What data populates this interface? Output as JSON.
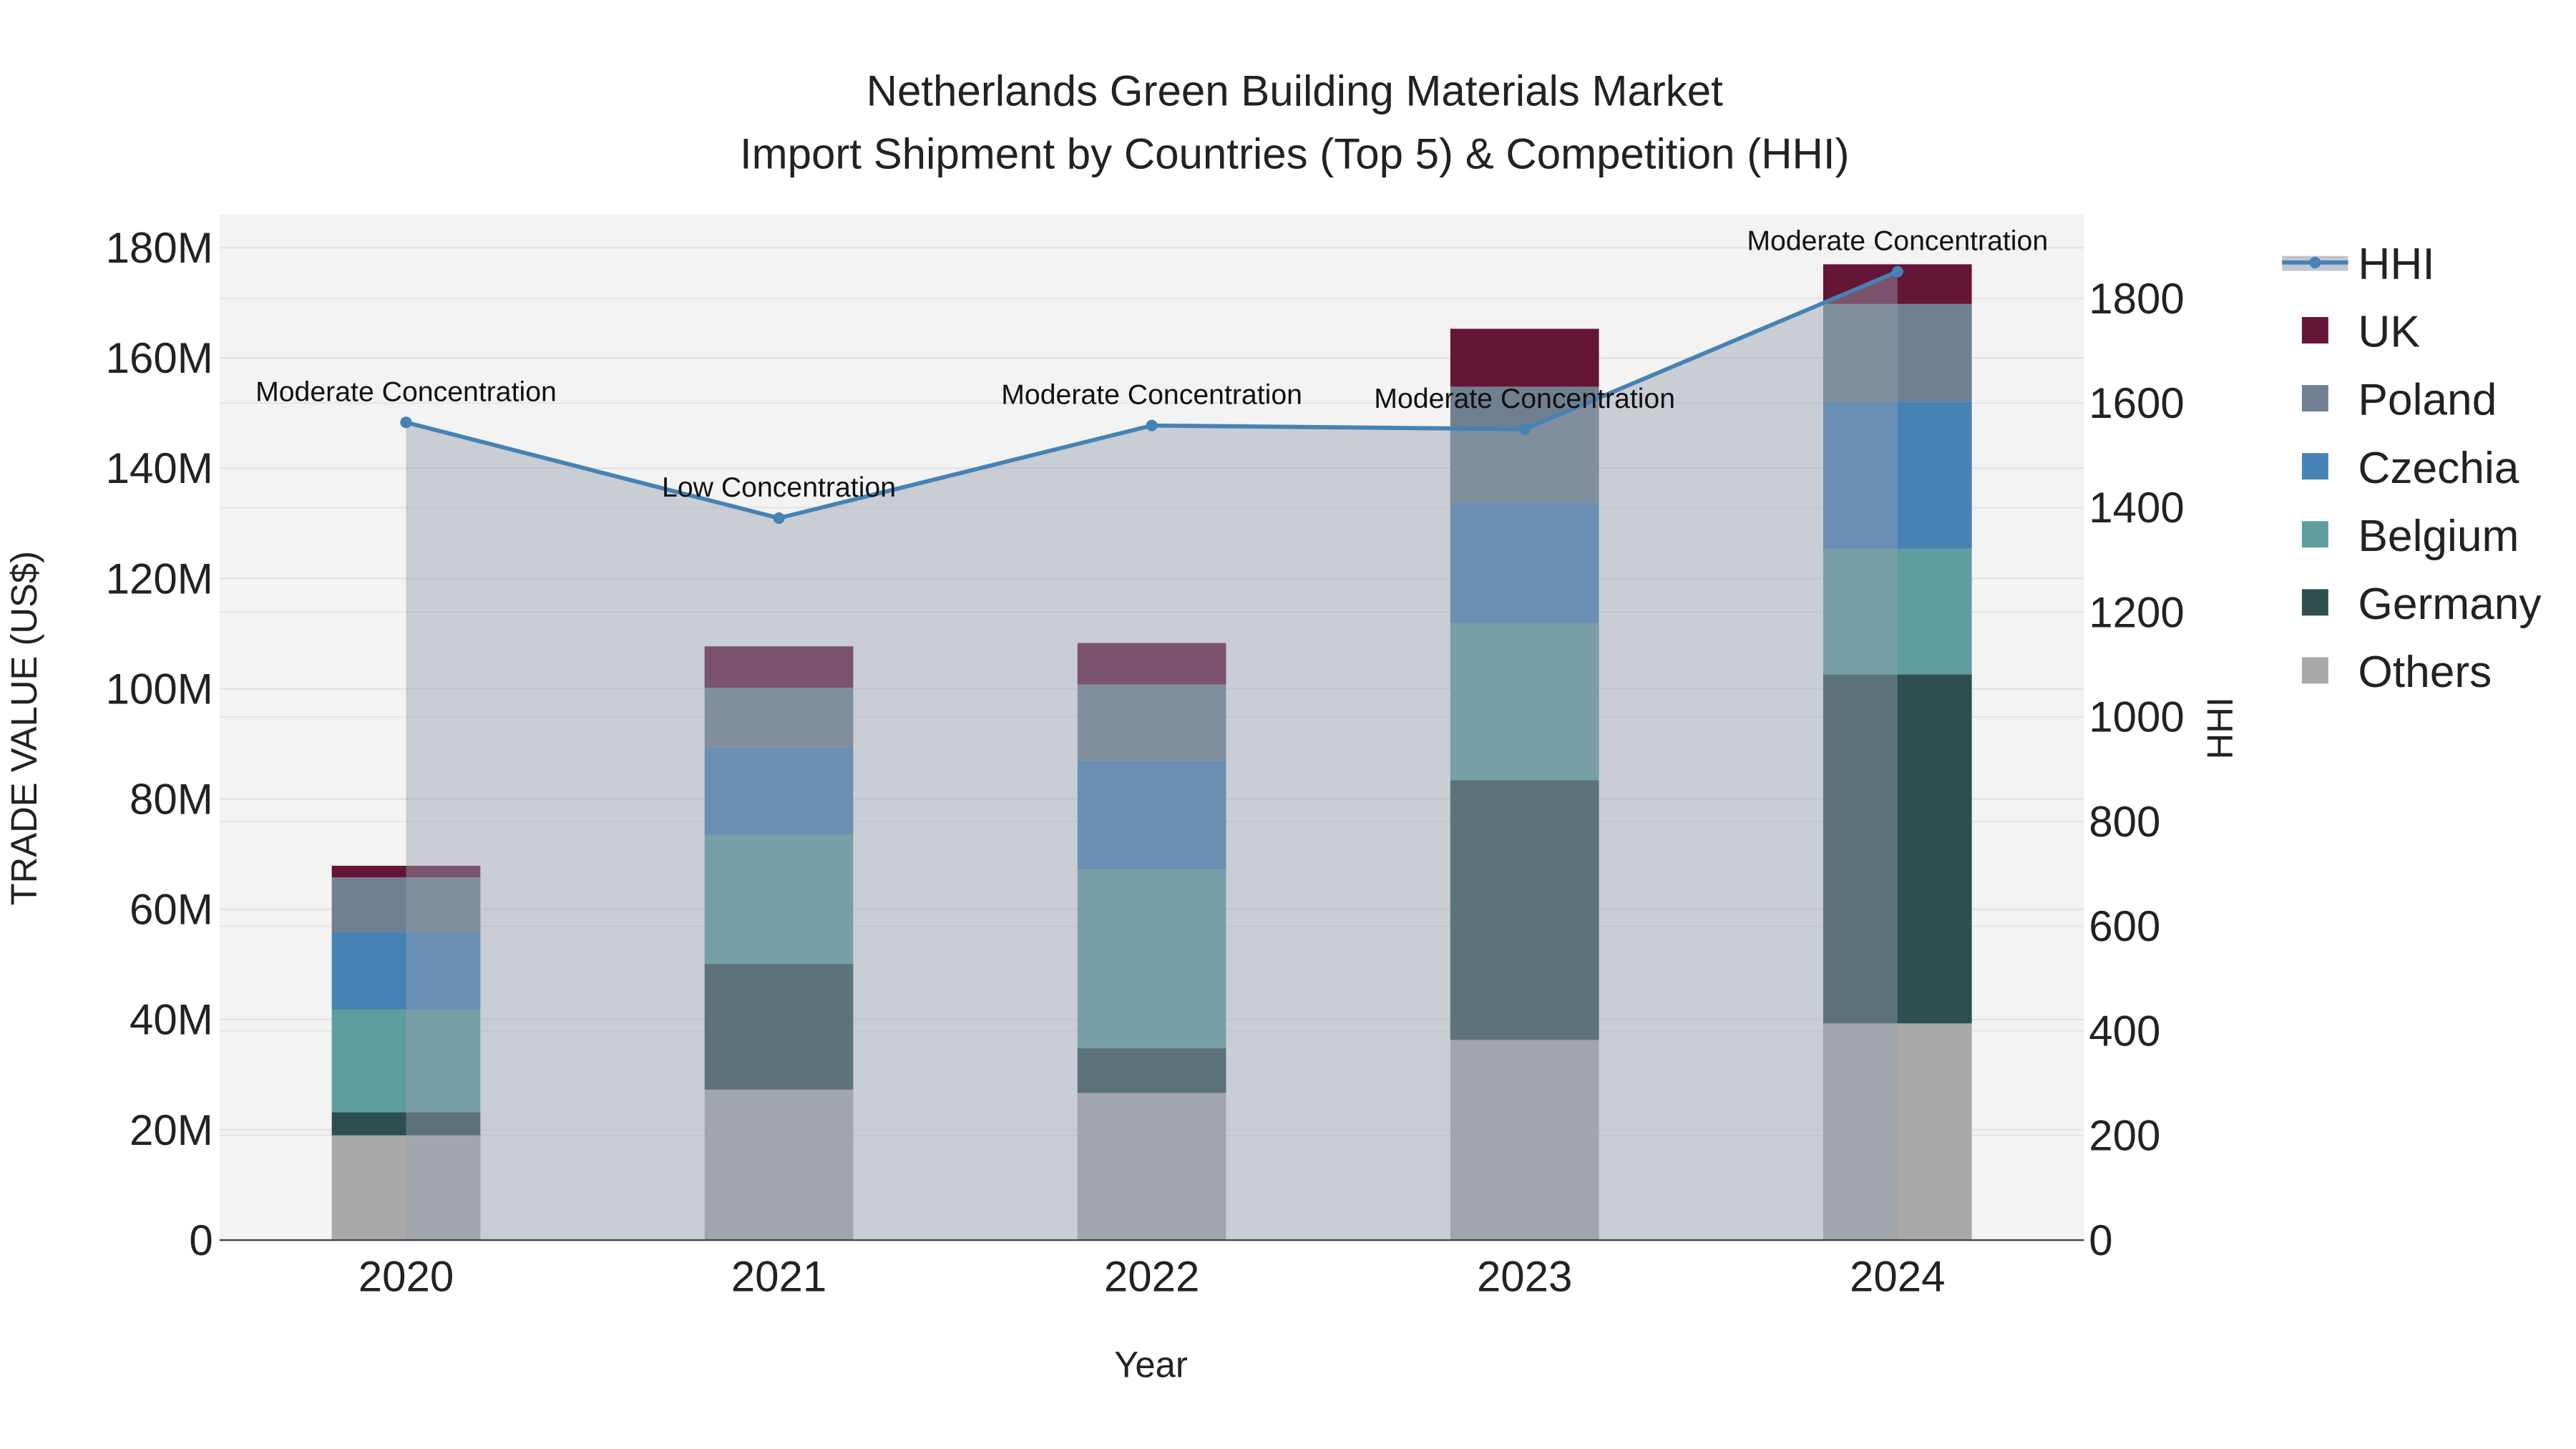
{
  "chart_data": {
    "type": "bar",
    "title": "Netherlands Green Building Materials Market",
    "subtitle": "Import Shipment by Countries (Top 5) & Competition (HHI)",
    "xlabel": "Year",
    "ylabel": "TRADE VALUE (US$)",
    "y2label": "HHI",
    "categories": [
      "2020",
      "2021",
      "2022",
      "2023",
      "2024"
    ],
    "ylim": [
      0,
      186
    ],
    "y_ticks": [
      0,
      20,
      40,
      60,
      80,
      100,
      120,
      140,
      160,
      180
    ],
    "y_tick_labels": [
      "0",
      "20M",
      "40M",
      "60M",
      "80M",
      "100M",
      "120M",
      "140M",
      "160M",
      "180M"
    ],
    "y2lim": [
      0,
      1960
    ],
    "y2_ticks": [
      0,
      200,
      400,
      600,
      800,
      1000,
      1200,
      1400,
      1600,
      1800
    ],
    "y2_tick_labels": [
      "0",
      "200",
      "400",
      "600",
      "800",
      "1000",
      "1200",
      "1400",
      "1600",
      "1800"
    ],
    "stacked": true,
    "units": "US$ millions",
    "series": [
      {
        "name": "Others",
        "color": "#a9a9a9",
        "values": [
          19.0,
          27.3,
          26.7,
          36.3,
          39.3
        ]
      },
      {
        "name": "Germany",
        "color": "#2f4f4f",
        "values": [
          4.2,
          22.8,
          8.1,
          47.1,
          63.3
        ]
      },
      {
        "name": "Belgium",
        "color": "#5f9ea0",
        "values": [
          18.6,
          23.4,
          32.4,
          28.5,
          22.8
        ]
      },
      {
        "name": "Czechia",
        "color": "#4682b4",
        "values": [
          14.1,
          15.9,
          19.8,
          21.9,
          26.7
        ]
      },
      {
        "name": "Poland",
        "color": "#708090",
        "values": [
          9.9,
          10.8,
          13.8,
          21.0,
          17.7
        ]
      },
      {
        "name": "UK",
        "color": "#651535",
        "values": [
          2.1,
          7.5,
          7.5,
          10.5,
          7.2
        ]
      }
    ],
    "line": {
      "name": "HHI",
      "color": "#4682b4",
      "values": [
        1563,
        1380,
        1557,
        1550,
        1851
      ],
      "annotations": [
        "Moderate Concentration",
        "Low Concentration",
        "Moderate Concentration",
        "Moderate Concentration",
        "Moderate Concentration"
      ]
    },
    "legend": [
      "HHI",
      "UK",
      "Poland",
      "Czechia",
      "Belgium",
      "Germany",
      "Others"
    ],
    "legend_position": "right",
    "grid": true
  }
}
